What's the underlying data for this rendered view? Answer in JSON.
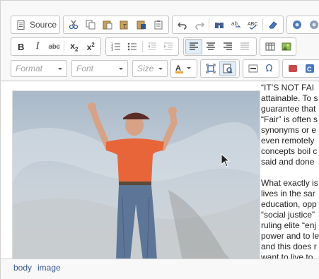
{
  "toolbar": {
    "source_label": "Source",
    "format_placeholder": "Format",
    "font_placeholder": "Font",
    "size_placeholder": "Size"
  },
  "article": {
    "paragraph1": [
      "“IT’S NOT FAI",
      "attainable. To s",
      "guarantee that",
      "“Fair” is often s",
      "synonyms or e",
      "even remotely",
      "concepts boil c",
      "said and done"
    ],
    "paragraph2": [
      "What exactly is",
      "lives in the sar",
      "education, opp",
      "“social justice”",
      "ruling elite “enj",
      "power and to le",
      "and this does r",
      "want to live to"
    ]
  },
  "statusbar": {
    "path": [
      "body",
      "image"
    ]
  },
  "colors": {
    "toolbar_bg": "#f8f8f8",
    "active_button": "#e1edf7",
    "status_link": "#3b5998",
    "shirt_orange": "#e8653a"
  }
}
